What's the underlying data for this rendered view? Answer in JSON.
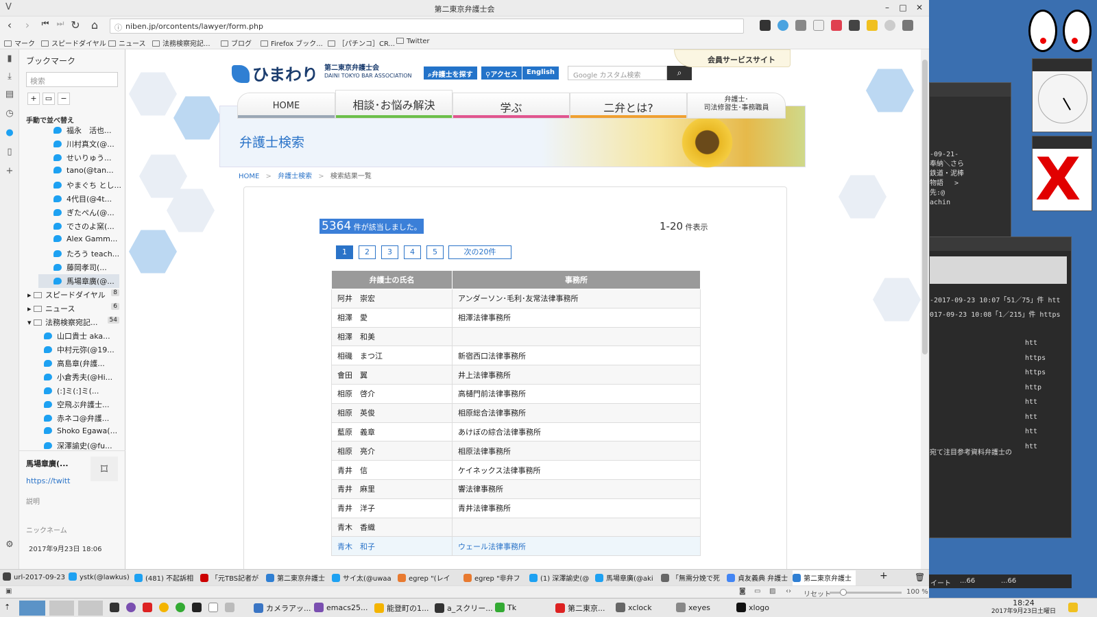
{
  "window": {
    "title": "第二東京弁護士会"
  },
  "address": {
    "url": "niben.jp/orcontents/lawyer/form.php"
  },
  "bookmarks_bar": [
    "マーク",
    "スピードダイヤル",
    "ニュース",
    "法務検察宛記...",
    "ブログ",
    "Firefox ブック...",
    "［パチンコ］CR...",
    "Twitter"
  ],
  "sidebar": {
    "title": "ブックマーク",
    "search_placeholder": "検索",
    "sort_label": "手動で並べ替え",
    "items": [
      {
        "label": "福永　活也..."
      },
      {
        "label": "川村真文(@..."
      },
      {
        "label": "せいりゅう..."
      },
      {
        "label": "tano(@tan..."
      },
      {
        "label": "やまぐち とし..."
      },
      {
        "label": "4代目(@4t..."
      },
      {
        "label": "ぎたぺん(@..."
      },
      {
        "label": "でさのよ窯(..."
      },
      {
        "label": "Alex Gamm..."
      },
      {
        "label": "たろう teach..."
      },
      {
        "label": "藤岡孝司(..."
      },
      {
        "label": "馬場章廣(@..."
      }
    ],
    "folders": [
      {
        "label": "スピードダイヤル",
        "count": "8"
      },
      {
        "label": "ニュース",
        "count": "6"
      },
      {
        "label": "法務検察宛記...",
        "count": "54"
      }
    ],
    "sub_items": [
      {
        "label": "山口貴士 aka..."
      },
      {
        "label": "中村元弥(@19..."
      },
      {
        "label": "高島章(弁護..."
      },
      {
        "label": "小倉秀夫(@Hi..."
      },
      {
        "label": "(:]ミ(:]ミ(..."
      },
      {
        "label": "空飛ぶ弁護士..."
      },
      {
        "label": "赤ネコ@弁護..."
      },
      {
        "label": "Shoko Egawa(..."
      },
      {
        "label": "深澤諭史(@fu..."
      }
    ],
    "detail": {
      "name": "馬場章廣(...",
      "url": "https://twitt",
      "desc_label": "説明",
      "nick_label": "ニックネーム",
      "date": "2017年9月23日 18:06"
    }
  },
  "site": {
    "logo": "ひまわり",
    "logo_sub1": "第二東京弁護士会",
    "logo_sub2": "DAINI TOKYO BAR ASSOCIATION",
    "btn_find": "弁護士を探す",
    "btn_access": "アクセス",
    "btn_english": "English",
    "search_placeholder": "Google カスタム検索",
    "member": "会員サービスサイト",
    "nav": [
      {
        "label": "HOME",
        "color": "#9aa7b5"
      },
      {
        "label": "相談･お悩み解決",
        "color": "#6cbf4a"
      },
      {
        "label": "学ぶ",
        "color": "#e0558f"
      },
      {
        "label": "二弁とは?",
        "color": "#f0a030"
      },
      {
        "label": "弁護士･\n司法修習生･事務職員",
        "color": "#dddddd"
      }
    ],
    "page_title": "弁護士検索",
    "breadcrumb": {
      "home": "HOME",
      "search": "弁護士検索",
      "current": "検索結果一覧"
    },
    "result_count": "5364",
    "result_suffix": "件が該当しました。",
    "range": "1-20",
    "range_suffix": "件表示",
    "pages": [
      "1",
      "2",
      "3",
      "4",
      "5"
    ],
    "next_label": "次の20件",
    "table": {
      "headers": [
        "弁護士の氏名",
        "事務所"
      ],
      "rows": [
        [
          "阿井　崇宏",
          "アンダーソン･毛利･友常法律事務所"
        ],
        [
          "相澤　愛",
          "相澤法律事務所"
        ],
        [
          "相澤　和美",
          ""
        ],
        [
          "相磯　まつ江",
          "新宿西口法律事務所"
        ],
        [
          "會田　翼",
          "井上法律事務所"
        ],
        [
          "相原　啓介",
          "高樋門前法律事務所"
        ],
        [
          "相原　英俊",
          "相原総合法律事務所"
        ],
        [
          "藍原　義章",
          "あけぼの綜合法律事務所"
        ],
        [
          "相原　亮介",
          "相原法律事務所"
        ],
        [
          "青井　信",
          "ケイネックス法律事務所"
        ],
        [
          "青井　麻里",
          "響法律事務所"
        ],
        [
          "青井　洋子",
          "青井法律事務所"
        ],
        [
          "青木　香織",
          ""
        ],
        [
          "青木　和子",
          "ウェール法律事務所"
        ]
      ]
    }
  },
  "tabs": [
    "url-2017-09-23",
    "ystk(@lawkus)",
    "(481) 不起訴相",
    "「元TBS記者が",
    "第二東京弁護士",
    "サイ太(@uwaa",
    "egrep \"(レイ",
    "egrep \"非弁フ",
    "(1) 深澤諭史(@",
    "馬場章廣(@aki",
    "「無需分娩で死",
    "貞友義典 弁護士",
    "第二東京弁護士"
  ],
  "statusbar": {
    "reset": "リセット",
    "zoom": "100 %"
  },
  "taskbar": {
    "items": [
      "カメラアッ...",
      "emacs25...",
      "能登町の1...",
      "a_スクリー...",
      "Tk",
      "第二東京...",
      "xclock",
      "xeyes",
      "xlogo"
    ],
    "time": "18:24",
    "date": "2017年9月23日土曜日"
  },
  "terminal": {
    "lines_a": [
      "-09-21-",
      "奉納＼さら",
      "鉄道・泥棒",
      "物語　 >",
      "先:@",
      "achin"
    ],
    "lines_b": [
      "-2017-09-23 10:07「51／75」件 htt",
      "017-09-23 10:08「1／215」件 https"
    ],
    "lines_c": [
      "htt",
      "https",
      "https",
      "http",
      "htt",
      "htt",
      "htt",
      "htt"
    ],
    "lines_d": [
      "宛て注目参考資料弁護士の"
    ],
    "tail": [
      "イート",
      "...66",
      "...66"
    ]
  }
}
